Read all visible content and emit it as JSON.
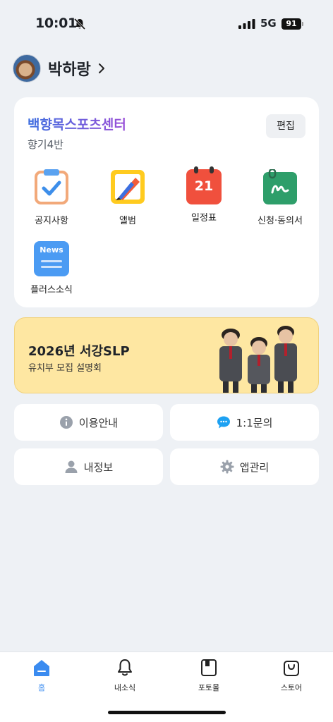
{
  "status_bar": {
    "time": "10:01",
    "network": "5G",
    "battery": "91"
  },
  "profile": {
    "name": "박하랑"
  },
  "card": {
    "center_name": "백향목스포츠센터",
    "class_name": "향기4반",
    "edit_label": "편집",
    "menu": [
      {
        "label": "공지사항",
        "icon": "notice-clipboard-icon"
      },
      {
        "label": "앨범",
        "icon": "album-icon"
      },
      {
        "label": "일정표",
        "icon": "calendar-icon",
        "day": "21"
      },
      {
        "label": "신청·동의서",
        "icon": "consent-form-icon"
      },
      {
        "label": "플러스소식",
        "icon": "news-icon",
        "badge": "News"
      }
    ]
  },
  "banner": {
    "title": "2026년 서강SLP",
    "subtitle": "유치부 모집 설명회"
  },
  "quick_links": [
    {
      "label": "이용안내",
      "icon": "info-icon"
    },
    {
      "label": "1:1문의",
      "icon": "chat-bubble-icon"
    },
    {
      "label": "내정보",
      "icon": "person-icon"
    },
    {
      "label": "앱관리",
      "icon": "gear-icon"
    }
  ],
  "tabbar": {
    "active": "홈",
    "tabs": [
      {
        "label": "홈",
        "icon": "home-icon"
      },
      {
        "label": "내소식",
        "icon": "bell-icon"
      },
      {
        "label": "포토몰",
        "icon": "photo-book-icon"
      },
      {
        "label": "스토어",
        "icon": "shopping-bag-icon"
      }
    ]
  },
  "colors": {
    "accent": "#3a8bf0",
    "background": "#EEF1F5",
    "banner": "#FEE7A2"
  }
}
